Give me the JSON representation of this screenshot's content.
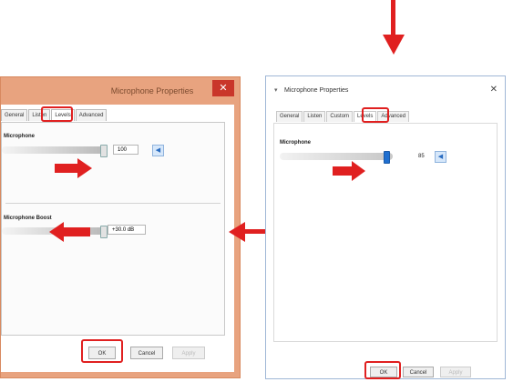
{
  "left_window": {
    "title": "Microphone Properties",
    "close_glyph": "✕",
    "tabs": [
      "General",
      "Listen",
      "Levels",
      "Advanced"
    ],
    "active_tab": 2,
    "microphone_label": "Microphone",
    "microphone_value": "100",
    "boost_label": "Microphone Boost",
    "boost_value": "+30.0 dB",
    "buttons": {
      "ok": "OK",
      "cancel": "Cancel",
      "apply": "Apply"
    }
  },
  "right_window": {
    "title": "Microphone Properties",
    "close_glyph": "✕",
    "tabs": [
      "General",
      "Listen",
      "Custom",
      "Levels",
      "Advanced"
    ],
    "active_tab": 3,
    "microphone_label": "Microphone",
    "microphone_value": "85",
    "buttons": {
      "ok": "OK",
      "cancel": "Cancel",
      "apply": "Apply"
    }
  },
  "colors": {
    "highlight": "#e02020",
    "win8_frame": "#e8a37f",
    "win10_frame": "#9fb7d6"
  },
  "icons": {
    "speaker": "speaker-icon",
    "app": "microphone-app-icon"
  }
}
